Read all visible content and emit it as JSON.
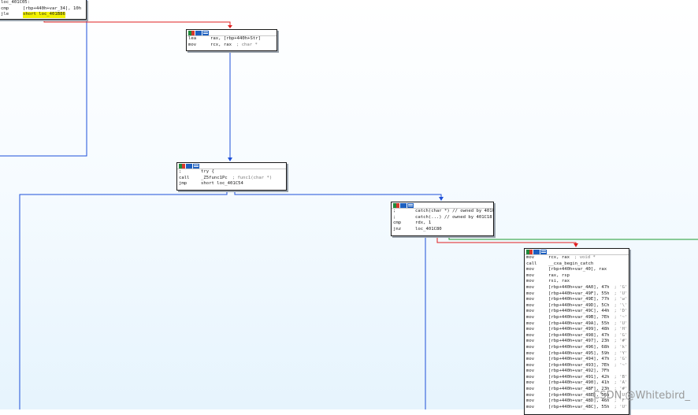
{
  "colors": {
    "true_edge": "#1f9a2f",
    "false_edge": "#e02020",
    "flow_edge": "#1d4fd8"
  },
  "nodes": {
    "n1": {
      "lines": [
        {
          "op": "loc_401C05:",
          "arg": "",
          "cmt": ""
        },
        {
          "op": "cmp",
          "arg": "[rbp+440h+var_34], 10h",
          "cmt": ""
        },
        {
          "op": "jle",
          "arg": "short loc_401B86",
          "cmt": ""
        }
      ]
    },
    "n2": {
      "lines": [
        {
          "op": "lea",
          "arg": "rax, [rbp+440h+Str]",
          "cmt": ""
        },
        {
          "op": "mov",
          "arg": "rcx, rax",
          "cmt": "; char *"
        }
      ]
    },
    "n3": {
      "lines": [
        {
          "op": ";",
          "arg": "try {",
          "cmt": ""
        },
        {
          "op": "call",
          "arg": "_Z5func1Pc",
          "cmt": "; func1(char *)"
        },
        {
          "op": "jmp",
          "arg": "short loc_401C54",
          "cmt": ""
        }
      ]
    },
    "n4": {
      "lines": [
        {
          "op": ";",
          "arg": "catch(char *) // owned by 401C18",
          "cmt": ""
        },
        {
          "op": ";",
          "arg": "catch(...) // owned by 401C18",
          "cmt": ""
        },
        {
          "op": "cmp",
          "arg": "rdx, 1",
          "cmt": ""
        },
        {
          "op": "jnz",
          "arg": "loc_401C80",
          "cmt": ""
        }
      ]
    },
    "n5": {
      "lines": [
        {
          "op": "mov",
          "arg": "rcx, rax",
          "cmt": "; void *"
        },
        {
          "op": "call",
          "arg": "__cxa_begin_catch",
          "cmt": ""
        },
        {
          "op": "mov",
          "arg": "[rbp+440h+var_40], rax",
          "cmt": ""
        },
        {
          "op": "mov",
          "arg": "rax, rsp",
          "cmt": ""
        },
        {
          "op": "mov",
          "arg": "rsi, rax",
          "cmt": ""
        },
        {
          "op": "mov",
          "arg": "[rbp+440h+var_4A0], 47h",
          "cmt": "; 'G'"
        },
        {
          "op": "mov",
          "arg": "[rbp+440h+var_49F], 55h",
          "cmt": "; 'U'"
        },
        {
          "op": "mov",
          "arg": "[rbp+440h+var_49E], 77h",
          "cmt": "; 'w'"
        },
        {
          "op": "mov",
          "arg": "[rbp+440h+var_49D], 5Ch",
          "cmt": "; '\\'"
        },
        {
          "op": "mov",
          "arg": "[rbp+440h+var_49C], 44h",
          "cmt": "; 'D'"
        },
        {
          "op": "mov",
          "arg": "[rbp+440h+var_49B], 7Eh",
          "cmt": "; '~'"
        },
        {
          "op": "mov",
          "arg": "[rbp+440h+var_49A], 55h",
          "cmt": "; 'U'"
        },
        {
          "op": "mov",
          "arg": "[rbp+440h+var_499], 48h",
          "cmt": "; 'H'"
        },
        {
          "op": "mov",
          "arg": "[rbp+440h+var_498], 47h",
          "cmt": "; 'G'"
        },
        {
          "op": "mov",
          "arg": "[rbp+440h+var_497], 23h",
          "cmt": "; '#'"
        },
        {
          "op": "mov",
          "arg": "[rbp+440h+var_496], 68h",
          "cmt": "; 'k'"
        },
        {
          "op": "mov",
          "arg": "[rbp+440h+var_495], 59h",
          "cmt": "; 'Y'"
        },
        {
          "op": "mov",
          "arg": "[rbp+440h+var_494], 47h",
          "cmt": "; 'G'"
        },
        {
          "op": "mov",
          "arg": "[rbp+440h+var_493], 7Eh",
          "cmt": "; '~'"
        },
        {
          "op": "mov",
          "arg": "[rbp+440h+var_492], 7Fh",
          "cmt": ""
        },
        {
          "op": "mov",
          "arg": "[rbp+440h+var_491], 42h",
          "cmt": "; 'B'"
        },
        {
          "op": "mov",
          "arg": "[rbp+440h+var_490], 41h",
          "cmt": "; 'A'"
        },
        {
          "op": "mov",
          "arg": "[rbp+440h+var_48F], 23h",
          "cmt": "; '#'"
        },
        {
          "op": "mov",
          "arg": "[rbp+440h+var_48E], 55h",
          "cmt": "; 'U'"
        },
        {
          "op": "mov",
          "arg": "[rbp+440h+var_48D], 46h",
          "cmt": "; 'F'"
        },
        {
          "op": "mov",
          "arg": "[rbp+440h+var_48C], 55h",
          "cmt": "; 'U'"
        }
      ]
    }
  },
  "watermark": "CSDN @Whitebird_"
}
